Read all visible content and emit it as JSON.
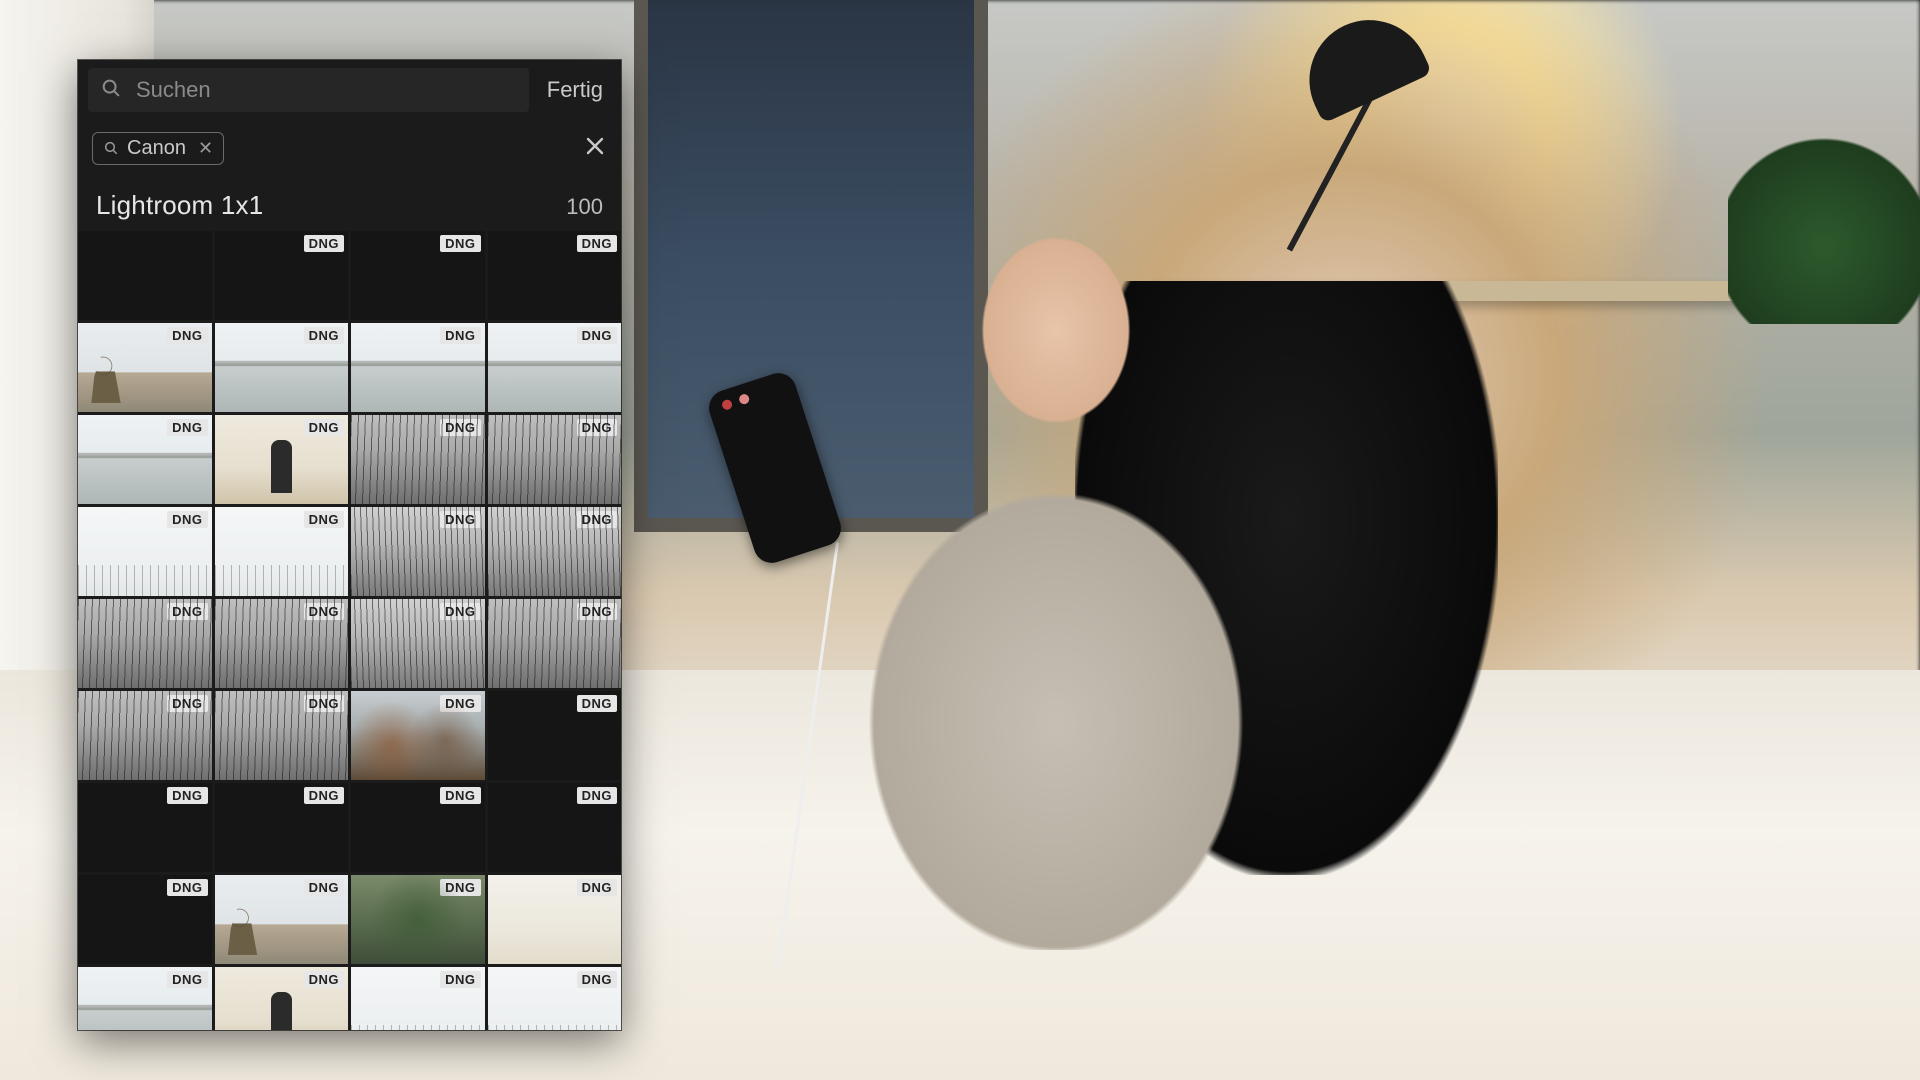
{
  "search": {
    "placeholder": "Suchen",
    "done_label": "Fertig"
  },
  "filters": {
    "chips": [
      {
        "label": "Canon"
      }
    ]
  },
  "album": {
    "title": "Lightroom 1x1",
    "count": "100"
  },
  "badge_text": "DNG",
  "grid_rows": [
    [
      {
        "look": "t-dark",
        "badge_align": "right"
      },
      {
        "look": "t-dark"
      },
      {
        "look": "t-dark"
      },
      {
        "look": "t-dark"
      }
    ],
    [
      {
        "look": "t-sky"
      },
      {
        "look": "t-lake"
      },
      {
        "look": "t-lake"
      },
      {
        "look": "t-lake"
      }
    ],
    [
      {
        "look": "t-lake"
      },
      {
        "look": "t-person"
      },
      {
        "look": "t-bw"
      },
      {
        "look": "t-bw"
      }
    ],
    [
      {
        "look": "t-white"
      },
      {
        "look": "t-white"
      },
      {
        "look": "t-bw2"
      },
      {
        "look": "t-bw2"
      }
    ],
    [
      {
        "look": "t-bw"
      },
      {
        "look": "t-bw"
      },
      {
        "look": "t-bw2"
      },
      {
        "look": "t-bw"
      }
    ],
    [
      {
        "look": "t-bw"
      },
      {
        "look": "t-bw"
      },
      {
        "look": "t-autumn"
      },
      {
        "look": "t-dark"
      }
    ],
    [
      {
        "look": "t-dark"
      },
      {
        "look": "t-dark"
      },
      {
        "look": "t-dark"
      },
      {
        "look": "t-dark"
      }
    ],
    [
      {
        "look": "t-dark"
      },
      {
        "look": "t-sky"
      },
      {
        "look": "t-green"
      },
      {
        "look": "t-bright"
      }
    ],
    [
      {
        "look": "t-lake"
      },
      {
        "look": "t-person"
      },
      {
        "look": "t-white"
      },
      {
        "look": "t-white"
      }
    ]
  ]
}
